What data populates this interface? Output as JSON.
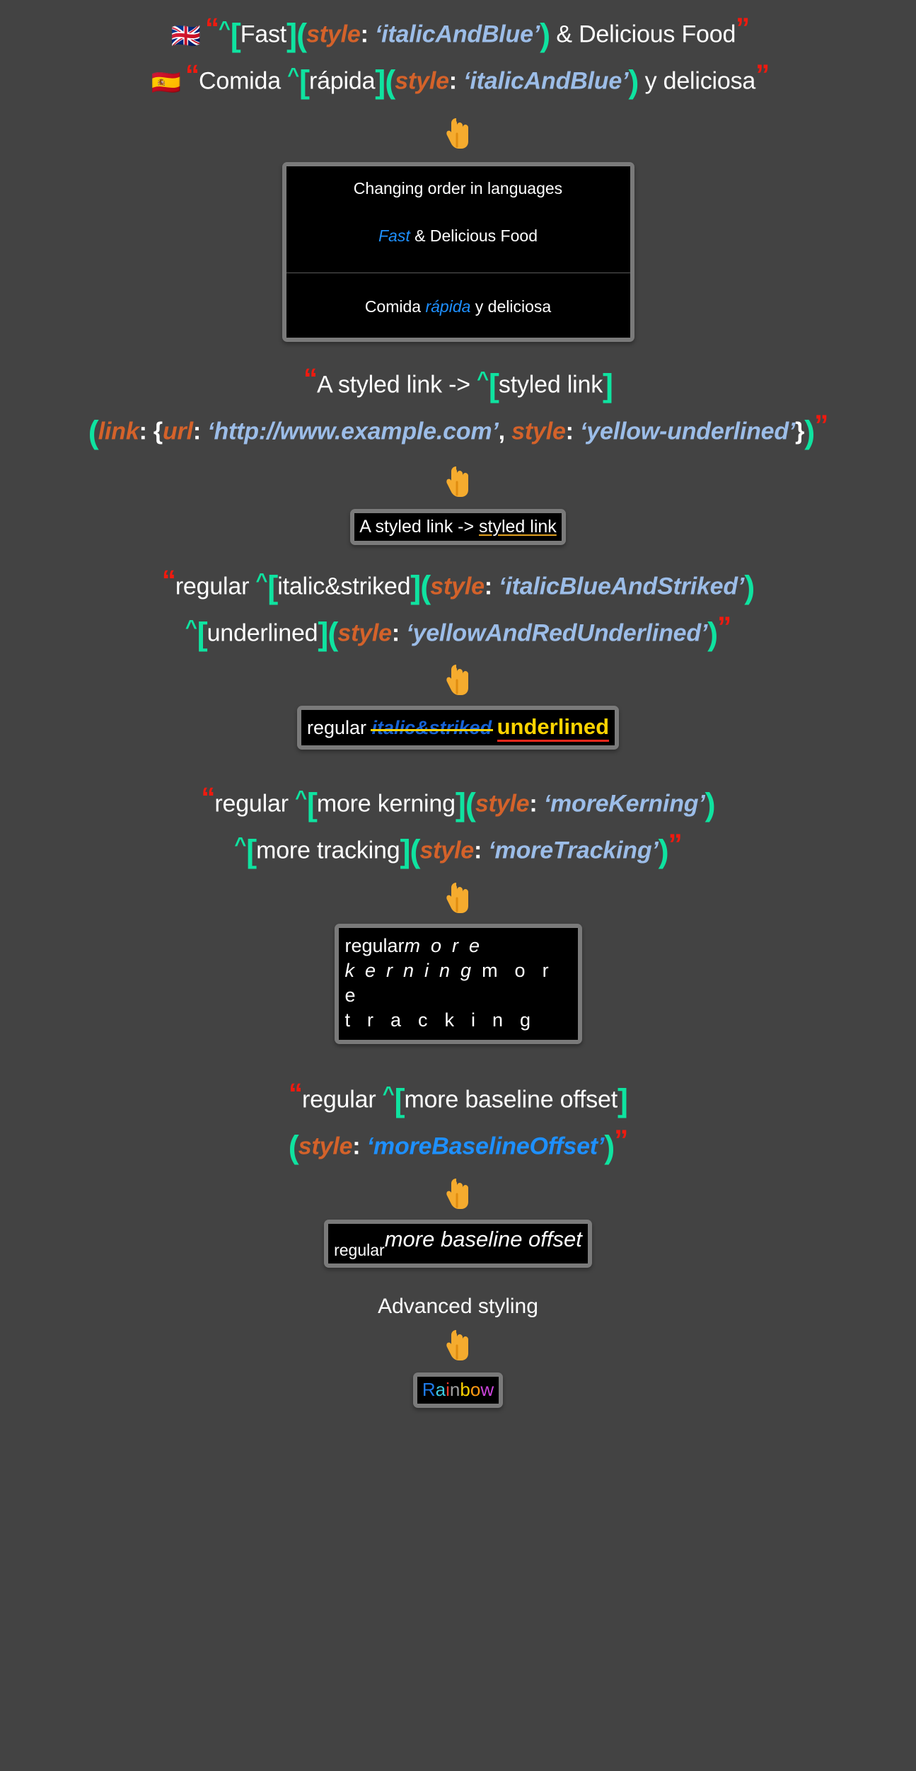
{
  "page": {
    "background_color": "#434343",
    "text_color": "#ffffff"
  },
  "palette": {
    "quote_red": "#f01a0f",
    "bracket_green": "#0fe3a0",
    "key_orange": "#d4622a",
    "value_blue": "#9cbde8",
    "value_blue_bright": "#1e90ff",
    "card_frame_gray": "#7a7a7a",
    "card_bg_black": "#000000",
    "hand_yellow": "#f5ab2e",
    "underline_gold": "#e0a020",
    "strike_yellow": "#ffd400",
    "underline_red": "#f0271b"
  },
  "sections": [
    {
      "id": "languages",
      "source_lines": [
        {
          "flag": "🇬🇧",
          "flag_name": "uk-flag",
          "tokens": [
            {
              "t": "open_quote",
              "text": "“"
            },
            {
              "t": "caret",
              "text": "^"
            },
            {
              "t": "bracket",
              "text": "["
            },
            {
              "t": "plain",
              "text": "Fast"
            },
            {
              "t": "bracket",
              "text": "]"
            },
            {
              "t": "paren",
              "text": "("
            },
            {
              "t": "key",
              "text": "style"
            },
            {
              "t": "colon",
              "text": ":"
            },
            {
              "t": "value",
              "text": "‘italicAndBlue’"
            },
            {
              "t": "paren",
              "text": ")"
            },
            {
              "t": "plain",
              "text": " & Delicious Food"
            },
            {
              "t": "close_quote",
              "text": "”"
            }
          ]
        },
        {
          "flag": "🇪🇸",
          "flag_name": "spain-flag",
          "tokens": [
            {
              "t": "open_quote",
              "text": "“"
            },
            {
              "t": "plain",
              "text": "Comida "
            },
            {
              "t": "caret",
              "text": "^"
            },
            {
              "t": "bracket",
              "text": "["
            },
            {
              "t": "plain",
              "text": "rápida"
            },
            {
              "t": "bracket",
              "text": "]"
            },
            {
              "t": "paren",
              "text": "("
            },
            {
              "t": "key",
              "text": "style"
            },
            {
              "t": "colon",
              "text": ":"
            },
            {
              "t": "value",
              "text": "‘italicAndBlue’"
            },
            {
              "t": "paren",
              "text": ")"
            },
            {
              "t": "plain",
              "text": " y deliciosa"
            },
            {
              "t": "close_quote",
              "text": "”"
            }
          ]
        }
      ],
      "preview": {
        "title": "Changing order in languages",
        "english": {
          "styled": "Fast",
          "rest": " & Delicious Food"
        },
        "spanish": {
          "before": "Comida ",
          "styled": "rápida",
          "rest": " y deliciosa"
        }
      }
    },
    {
      "id": "styled-link",
      "source_lines": [
        {
          "tokens": [
            {
              "t": "open_quote",
              "text": "“"
            },
            {
              "t": "plain",
              "text": "A styled link -> "
            },
            {
              "t": "caret",
              "text": "^"
            },
            {
              "t": "bracket",
              "text": "["
            },
            {
              "t": "plain",
              "text": "styled link"
            },
            {
              "t": "bracket",
              "text": "]"
            }
          ]
        },
        {
          "tokens": [
            {
              "t": "paren",
              "text": "("
            },
            {
              "t": "key",
              "text": "link"
            },
            {
              "t": "colon",
              "text": ":"
            },
            {
              "t": "brace",
              "text": " {"
            },
            {
              "t": "key",
              "text": "url"
            },
            {
              "t": "colon",
              "text": ":"
            },
            {
              "t": "value",
              "text": "‘http://www.example.com’"
            },
            {
              "t": "comma",
              "text": ","
            },
            {
              "t": "key",
              "text": " style"
            },
            {
              "t": "colon",
              "text": ":"
            },
            {
              "t": "value",
              "text": "‘yellow-underlined’"
            },
            {
              "t": "brace",
              "text": "}"
            },
            {
              "t": "paren",
              "text": ")"
            },
            {
              "t": "close_quote",
              "text": "”"
            }
          ]
        }
      ],
      "preview": {
        "before": "A styled link -> ",
        "link_text": "styled link"
      }
    },
    {
      "id": "italic-striked-underlined",
      "source_lines": [
        {
          "tokens": [
            {
              "t": "open_quote",
              "text": "“"
            },
            {
              "t": "plain",
              "text": "regular "
            },
            {
              "t": "caret",
              "text": "^"
            },
            {
              "t": "bracket",
              "text": "["
            },
            {
              "t": "plain",
              "text": "italic&striked"
            },
            {
              "t": "bracket",
              "text": "]"
            },
            {
              "t": "paren",
              "text": "("
            },
            {
              "t": "key",
              "text": "style"
            },
            {
              "t": "colon",
              "text": ":"
            },
            {
              "t": "value",
              "text": "‘italicBlueAndStriked’"
            },
            {
              "t": "paren",
              "text": ")"
            }
          ]
        },
        {
          "tokens": [
            {
              "t": "caret",
              "text": "^"
            },
            {
              "t": "bracket",
              "text": "["
            },
            {
              "t": "plain",
              "text": "underlined"
            },
            {
              "t": "bracket",
              "text": "]"
            },
            {
              "t": "paren",
              "text": "("
            },
            {
              "t": "key",
              "text": "style"
            },
            {
              "t": "colon",
              "text": ":"
            },
            {
              "t": "value",
              "text": "‘yellowAndRedUnderlined’"
            },
            {
              "t": "paren",
              "text": ")"
            },
            {
              "t": "close_quote",
              "text": "”"
            }
          ]
        }
      ],
      "preview": {
        "regular": "regular ",
        "striked": "italic&striked",
        "underlined": "underlined"
      }
    },
    {
      "id": "kerning-tracking",
      "source_lines": [
        {
          "tokens": [
            {
              "t": "open_quote",
              "text": "“"
            },
            {
              "t": "plain",
              "text": "regular "
            },
            {
              "t": "caret",
              "text": "^"
            },
            {
              "t": "bracket",
              "text": "["
            },
            {
              "t": "plain",
              "text": "more kerning"
            },
            {
              "t": "bracket",
              "text": "]"
            },
            {
              "t": "paren",
              "text": "("
            },
            {
              "t": "key",
              "text": "style"
            },
            {
              "t": "colon",
              "text": ":"
            },
            {
              "t": "value",
              "text": "‘moreKerning’"
            },
            {
              "t": "paren",
              "text": ")"
            }
          ]
        },
        {
          "tokens": [
            {
              "t": "caret",
              "text": "^"
            },
            {
              "t": "bracket",
              "text": "["
            },
            {
              "t": "plain",
              "text": "more tracking"
            },
            {
              "t": "bracket",
              "text": "]"
            },
            {
              "t": "paren",
              "text": "("
            },
            {
              "t": "key",
              "text": "style"
            },
            {
              "t": "colon",
              "text": ":"
            },
            {
              "t": "value",
              "text": "‘moreTracking’"
            },
            {
              "t": "paren",
              "text": ")"
            },
            {
              "t": "close_quote",
              "text": "”"
            }
          ]
        }
      ],
      "preview": {
        "regular": "regular",
        "kerning": "more kerning",
        "tracking": "more tracking"
      }
    },
    {
      "id": "baseline-offset",
      "source_lines": [
        {
          "tokens": [
            {
              "t": "open_quote",
              "text": "“"
            },
            {
              "t": "plain",
              "text": "regular "
            },
            {
              "t": "caret",
              "text": "^"
            },
            {
              "t": "bracket",
              "text": "["
            },
            {
              "t": "plain",
              "text": "more baseline offset"
            },
            {
              "t": "bracket",
              "text": "]"
            }
          ]
        },
        {
          "tokens": [
            {
              "t": "paren",
              "text": "("
            },
            {
              "t": "key",
              "text": "style"
            },
            {
              "t": "colon",
              "text": ":"
            },
            {
              "t": "value_bright",
              "text": "‘moreBaselineOffset’"
            },
            {
              "t": "paren",
              "text": ")"
            },
            {
              "t": "close_quote",
              "text": "”"
            }
          ]
        }
      ],
      "preview": {
        "regular": "regular",
        "offset": "more baseline offset"
      }
    },
    {
      "id": "advanced-styling",
      "title": "Advanced styling",
      "preview": {
        "word": "Rainbow",
        "letters": [
          {
            "char": "R",
            "color": "#1e7ae8"
          },
          {
            "char": "a",
            "color": "#3cc8e0"
          },
          {
            "char": "i",
            "color": "#ef3b2c"
          },
          {
            "char": "n",
            "color": "#a0a0a0"
          },
          {
            "char": "b",
            "color": "#ffd400"
          },
          {
            "char": "o",
            "color": "#ff9a12"
          },
          {
            "char": "w",
            "color": "#cc44dd"
          }
        ]
      }
    }
  ],
  "hand_icon": "pointing-down-hand"
}
